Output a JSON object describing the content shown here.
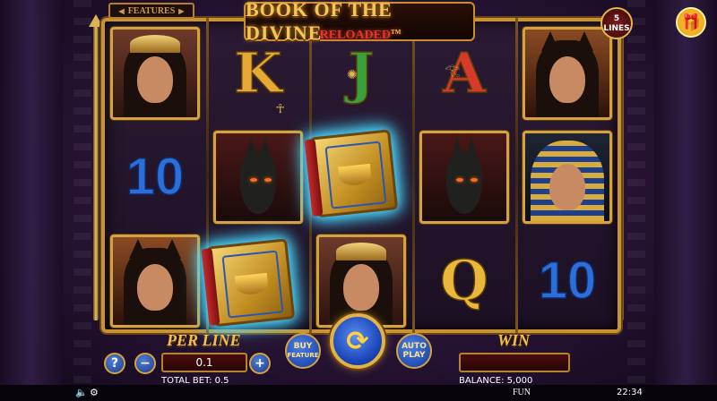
{
  "header": {
    "title": "BOOK OF THE DIVINE",
    "subtitle": "RELOADED",
    "trademark": "TM",
    "features_label": "FEATURES",
    "lines_count": "5",
    "lines_label": "LINES"
  },
  "reels": [
    [
      "cleopatra",
      "10",
      "bastet"
    ],
    [
      "K",
      "anubis",
      "book"
    ],
    [
      "J",
      "book",
      "cleopatra"
    ],
    [
      "A",
      "anubis",
      "Q"
    ],
    [
      "bastet",
      "pharaoh",
      "10"
    ]
  ],
  "controls": {
    "per_line_label": "PER LINE",
    "per_line_value": "0.1",
    "minus": "−",
    "plus": "+",
    "help": "?",
    "buy_feature": [
      "BUY",
      "FEATURE"
    ],
    "auto_play": [
      "AUTO",
      "PLAY"
    ],
    "win_label": "WIN",
    "win_value": "",
    "total_bet": "TOTAL BET: 0.5",
    "balance": "BALANCE: 5,000"
  },
  "status": {
    "mode": "FUN",
    "time": "22:34"
  },
  "colors": {
    "gold": "#d4a23f",
    "button_blue": "#1b3b8a",
    "field_red": "#4a0c0c",
    "book_glow": "#49d7ff"
  },
  "icons": [
    "gift-icon",
    "speaker-icon",
    "settings-icon",
    "spin-icon",
    "ankh-icon",
    "scarab-icon",
    "eye-of-horus-icon"
  ]
}
